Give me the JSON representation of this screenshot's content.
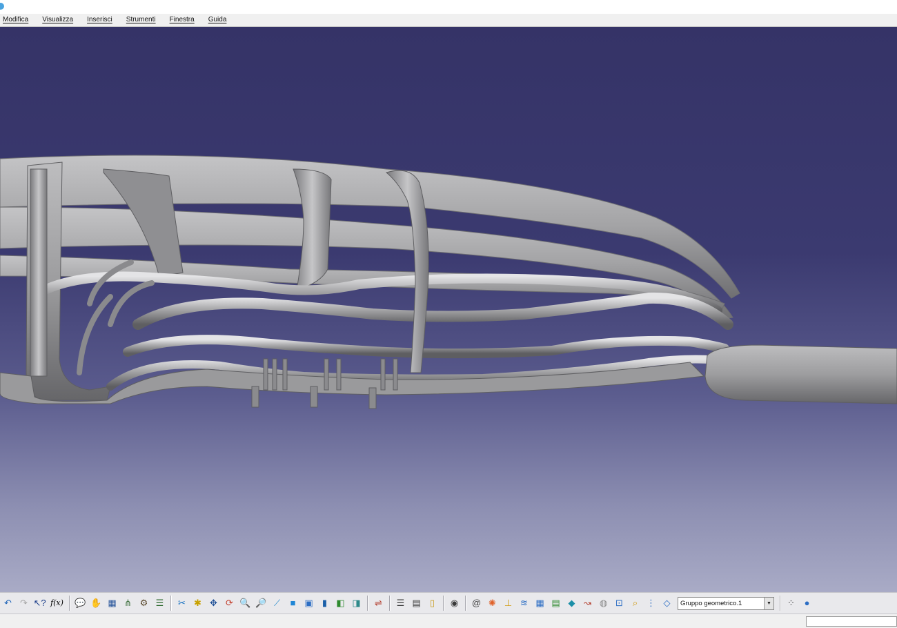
{
  "menu": {
    "items": [
      {
        "name": "menu-modifica",
        "label": "Modifica"
      },
      {
        "name": "menu-visualizza",
        "label": "Visualizza"
      },
      {
        "name": "menu-inserisci",
        "label": "Inserisci"
      },
      {
        "name": "menu-strumenti",
        "label": "Strumenti"
      },
      {
        "name": "menu-finestra",
        "label": "Finestra"
      },
      {
        "name": "menu-guida",
        "label": "Guida"
      }
    ]
  },
  "viewport": {
    "background_top": "#353367",
    "background_bottom": "#a9abc6",
    "model_color": "#9a9a9c"
  },
  "toolbar": {
    "formula_label": "f(x)",
    "geometric_set": {
      "selected": "Gruppo geometrico.1"
    },
    "icons": [
      {
        "name": "undo-icon",
        "glyph": "↶",
        "color": "#1d63b8"
      },
      {
        "name": "redo-icon",
        "glyph": "↷",
        "color": "#a7a7a7"
      },
      {
        "name": "whats-this-icon",
        "glyph": "↖?",
        "color": "#1d3f8a"
      },
      {
        "sep": true
      },
      {
        "name": "comment-icon",
        "glyph": "💬",
        "color": "#3b3b3b"
      },
      {
        "name": "hand-icon",
        "glyph": "✋",
        "color": "#b5b5b5"
      },
      {
        "name": "spreadsheet-icon",
        "glyph": "▦",
        "color": "#27549a"
      },
      {
        "name": "tree-icon",
        "glyph": "⋔",
        "color": "#3b6e3b"
      },
      {
        "name": "macro-icon",
        "glyph": "⚙",
        "color": "#5c4a2e"
      },
      {
        "name": "catalog-icon",
        "glyph": "☰",
        "color": "#2f6a2f"
      },
      {
        "sep": true
      },
      {
        "name": "fit-all-icon",
        "glyph": "✂",
        "color": "#1b73c2"
      },
      {
        "name": "fly-mode-icon",
        "glyph": "✱",
        "color": "#c8a100"
      },
      {
        "name": "pan-icon",
        "glyph": "✥",
        "color": "#1e4f96"
      },
      {
        "name": "rotate-icon",
        "glyph": "⟳",
        "color": "#c23c2a"
      },
      {
        "name": "zoom-in-icon",
        "glyph": "🔍",
        "color": "#2a5fa6"
      },
      {
        "name": "zoom-out-icon",
        "glyph": "🔎",
        "color": "#2a5fa6"
      },
      {
        "name": "normal-view-icon",
        "glyph": "⟋",
        "color": "#2b8dcc"
      },
      {
        "name": "iso-view-icon",
        "glyph": "■",
        "color": "#1f86d6"
      },
      {
        "name": "view-mode-icon",
        "glyph": "▣",
        "color": "#2d6ec4"
      },
      {
        "name": "shading-icon",
        "glyph": "▮",
        "color": "#1b5fa8"
      },
      {
        "name": "hide-show-icon",
        "glyph": "◧",
        "color": "#2e8a2e"
      },
      {
        "name": "swap-space-icon",
        "glyph": "◨",
        "color": "#2e8a8a"
      },
      {
        "sep": true
      },
      {
        "name": "measure-icon",
        "glyph": "⇌",
        "color": "#b23b2b"
      },
      {
        "sep": true
      },
      {
        "name": "stack-icon",
        "glyph": "☰",
        "color": "#3d3d3d"
      },
      {
        "name": "book-icon",
        "glyph": "▤",
        "color": "#3a3a3a"
      },
      {
        "name": "bottle-icon",
        "glyph": "▯",
        "color": "#c79a1a"
      },
      {
        "sep": true
      },
      {
        "name": "camera-icon",
        "glyph": "◉",
        "color": "#3a3a3a"
      },
      {
        "sep": true
      },
      {
        "name": "at-icon",
        "glyph": "@",
        "color": "#3b3b3b"
      },
      {
        "name": "sketch-icon",
        "glyph": "✺",
        "color": "#e0622a"
      },
      {
        "name": "axis-icon",
        "glyph": "⊥",
        "color": "#d09a10"
      },
      {
        "name": "lines-icon",
        "glyph": "≋",
        "color": "#2d6ec4"
      },
      {
        "name": "grid-icon",
        "glyph": "▦",
        "color": "#2d6ec4"
      },
      {
        "name": "cylinder-icon",
        "glyph": "▤",
        "color": "#2e8a2e"
      },
      {
        "name": "surface-icon",
        "glyph": "◆",
        "color": "#1b8fa8"
      },
      {
        "name": "curve-icon",
        "glyph": "↝",
        "color": "#b23b2b"
      },
      {
        "name": "blend-icon",
        "glyph": "◍",
        "color": "#8a8a8a"
      },
      {
        "name": "extract-icon",
        "glyph": "⊡",
        "color": "#2d6ec4"
      },
      {
        "name": "search-icon",
        "glyph": "⌕",
        "color": "#d09a10"
      },
      {
        "name": "column-icon",
        "glyph": "⋮",
        "color": "#2d6ec4"
      },
      {
        "name": "plane-icon",
        "glyph": "◇",
        "color": "#2d6ec4"
      }
    ],
    "trailing_icons": [
      {
        "name": "dots-icon",
        "glyph": "⁘",
        "color": "#3b3b3b"
      },
      {
        "name": "globe-icon",
        "glyph": "●",
        "color": "#2d6ec4"
      }
    ]
  }
}
